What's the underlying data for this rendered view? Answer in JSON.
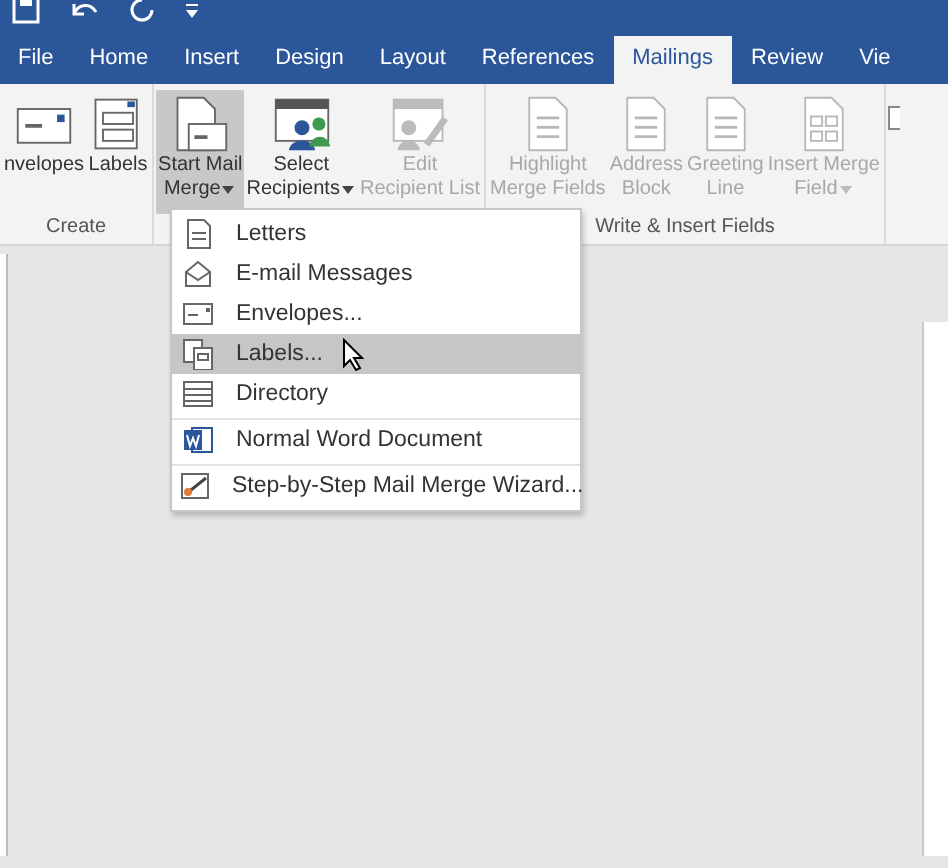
{
  "tabs": [
    {
      "label": "File",
      "selected": false
    },
    {
      "label": "Home",
      "selected": false
    },
    {
      "label": "Insert",
      "selected": false
    },
    {
      "label": "Design",
      "selected": false
    },
    {
      "label": "Layout",
      "selected": false
    },
    {
      "label": "References",
      "selected": false
    },
    {
      "label": "Mailings",
      "selected": true
    },
    {
      "label": "Review",
      "selected": false
    },
    {
      "label": "Vie",
      "selected": false
    }
  ],
  "ribbon_groups": [
    {
      "label": "Create",
      "buttons": [
        {
          "kind": "envelope",
          "lines": [
            "nvelopes"
          ],
          "dropdown": false,
          "disabled": false,
          "pressed": false
        },
        {
          "kind": "labels",
          "lines": [
            "Labels"
          ],
          "dropdown": false,
          "disabled": false,
          "pressed": false
        }
      ]
    },
    {
      "buttons": [
        {
          "kind": "merge",
          "lines": [
            "Start Mail",
            "Merge"
          ],
          "dropdown": true,
          "disabled": false,
          "pressed": true
        },
        {
          "kind": "recipients",
          "lines": [
            "Select",
            "Recipients"
          ],
          "dropdown": true,
          "disabled": false,
          "pressed": false
        },
        {
          "kind": "edit",
          "lines": [
            "Edit",
            "Recipient List"
          ],
          "dropdown": false,
          "disabled": true,
          "pressed": false
        }
      ]
    },
    {
      "label": "Write & Insert Fields",
      "buttons": [
        {
          "kind": "doc",
          "lines": [
            "Highlight",
            "Merge Fields"
          ],
          "dropdown": false,
          "disabled": true,
          "pressed": false
        },
        {
          "kind": "doc",
          "lines": [
            "Address",
            "Block"
          ],
          "dropdown": false,
          "disabled": true,
          "pressed": false
        },
        {
          "kind": "doc",
          "lines": [
            "Greeting",
            "Line"
          ],
          "dropdown": false,
          "disabled": true,
          "pressed": false
        },
        {
          "kind": "grid",
          "lines": [
            "Insert Merge",
            "Field"
          ],
          "dropdown": true,
          "disabled": true,
          "pressed": false
        }
      ]
    }
  ],
  "menu": {
    "items": [
      {
        "kind": "letter",
        "label": "Letters",
        "selected": false,
        "separator_before": false
      },
      {
        "kind": "email",
        "label": "E-mail Messages",
        "selected": false,
        "separator_before": false
      },
      {
        "kind": "envelope",
        "label": "Envelopes...",
        "selected": false,
        "separator_before": false
      },
      {
        "kind": "labels",
        "label": "Labels...",
        "selected": true,
        "separator_before": false
      },
      {
        "kind": "directory",
        "label": "Directory",
        "selected": false,
        "separator_before": false
      },
      {
        "kind": "word",
        "label": "Normal Word Document",
        "selected": false,
        "separator_before": true
      },
      {
        "kind": "wizard",
        "label": "Step-by-Step Mail Merge Wizard...",
        "selected": false,
        "separator_before": true
      }
    ]
  }
}
